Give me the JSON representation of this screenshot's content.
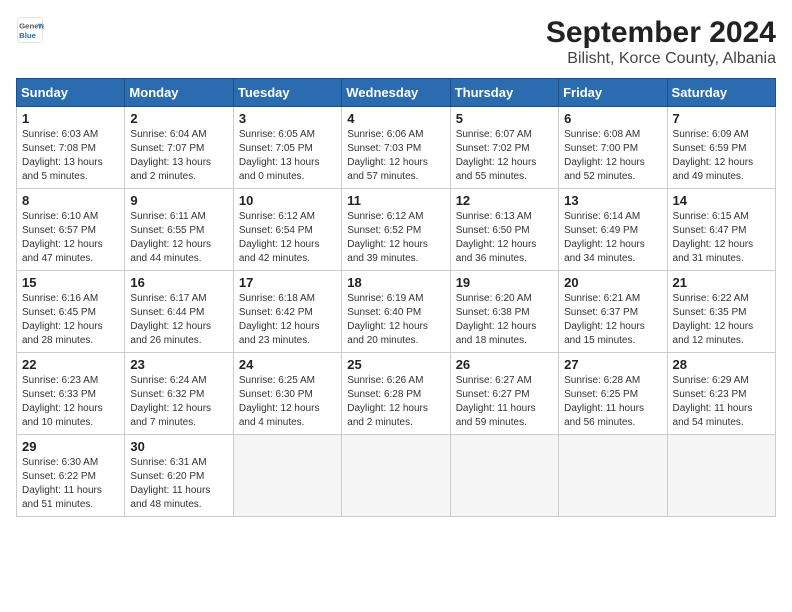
{
  "header": {
    "logo_line1": "General",
    "logo_line2": "Blue",
    "title": "September 2024",
    "subtitle": "Bilisht, Korce County, Albania"
  },
  "columns": [
    "Sunday",
    "Monday",
    "Tuesday",
    "Wednesday",
    "Thursday",
    "Friday",
    "Saturday"
  ],
  "weeks": [
    [
      {
        "day": "1",
        "info": "Sunrise: 6:03 AM\nSunset: 7:08 PM\nDaylight: 13 hours\nand 5 minutes."
      },
      {
        "day": "2",
        "info": "Sunrise: 6:04 AM\nSunset: 7:07 PM\nDaylight: 13 hours\nand 2 minutes."
      },
      {
        "day": "3",
        "info": "Sunrise: 6:05 AM\nSunset: 7:05 PM\nDaylight: 13 hours\nand 0 minutes."
      },
      {
        "day": "4",
        "info": "Sunrise: 6:06 AM\nSunset: 7:03 PM\nDaylight: 12 hours\nand 57 minutes."
      },
      {
        "day": "5",
        "info": "Sunrise: 6:07 AM\nSunset: 7:02 PM\nDaylight: 12 hours\nand 55 minutes."
      },
      {
        "day": "6",
        "info": "Sunrise: 6:08 AM\nSunset: 7:00 PM\nDaylight: 12 hours\nand 52 minutes."
      },
      {
        "day": "7",
        "info": "Sunrise: 6:09 AM\nSunset: 6:59 PM\nDaylight: 12 hours\nand 49 minutes."
      }
    ],
    [
      {
        "day": "8",
        "info": "Sunrise: 6:10 AM\nSunset: 6:57 PM\nDaylight: 12 hours\nand 47 minutes."
      },
      {
        "day": "9",
        "info": "Sunrise: 6:11 AM\nSunset: 6:55 PM\nDaylight: 12 hours\nand 44 minutes."
      },
      {
        "day": "10",
        "info": "Sunrise: 6:12 AM\nSunset: 6:54 PM\nDaylight: 12 hours\nand 42 minutes."
      },
      {
        "day": "11",
        "info": "Sunrise: 6:12 AM\nSunset: 6:52 PM\nDaylight: 12 hours\nand 39 minutes."
      },
      {
        "day": "12",
        "info": "Sunrise: 6:13 AM\nSunset: 6:50 PM\nDaylight: 12 hours\nand 36 minutes."
      },
      {
        "day": "13",
        "info": "Sunrise: 6:14 AM\nSunset: 6:49 PM\nDaylight: 12 hours\nand 34 minutes."
      },
      {
        "day": "14",
        "info": "Sunrise: 6:15 AM\nSunset: 6:47 PM\nDaylight: 12 hours\nand 31 minutes."
      }
    ],
    [
      {
        "day": "15",
        "info": "Sunrise: 6:16 AM\nSunset: 6:45 PM\nDaylight: 12 hours\nand 28 minutes."
      },
      {
        "day": "16",
        "info": "Sunrise: 6:17 AM\nSunset: 6:44 PM\nDaylight: 12 hours\nand 26 minutes."
      },
      {
        "day": "17",
        "info": "Sunrise: 6:18 AM\nSunset: 6:42 PM\nDaylight: 12 hours\nand 23 minutes."
      },
      {
        "day": "18",
        "info": "Sunrise: 6:19 AM\nSunset: 6:40 PM\nDaylight: 12 hours\nand 20 minutes."
      },
      {
        "day": "19",
        "info": "Sunrise: 6:20 AM\nSunset: 6:38 PM\nDaylight: 12 hours\nand 18 minutes."
      },
      {
        "day": "20",
        "info": "Sunrise: 6:21 AM\nSunset: 6:37 PM\nDaylight: 12 hours\nand 15 minutes."
      },
      {
        "day": "21",
        "info": "Sunrise: 6:22 AM\nSunset: 6:35 PM\nDaylight: 12 hours\nand 12 minutes."
      }
    ],
    [
      {
        "day": "22",
        "info": "Sunrise: 6:23 AM\nSunset: 6:33 PM\nDaylight: 12 hours\nand 10 minutes."
      },
      {
        "day": "23",
        "info": "Sunrise: 6:24 AM\nSunset: 6:32 PM\nDaylight: 12 hours\nand 7 minutes."
      },
      {
        "day": "24",
        "info": "Sunrise: 6:25 AM\nSunset: 6:30 PM\nDaylight: 12 hours\nand 4 minutes."
      },
      {
        "day": "25",
        "info": "Sunrise: 6:26 AM\nSunset: 6:28 PM\nDaylight: 12 hours\nand 2 minutes."
      },
      {
        "day": "26",
        "info": "Sunrise: 6:27 AM\nSunset: 6:27 PM\nDaylight: 11 hours\nand 59 minutes."
      },
      {
        "day": "27",
        "info": "Sunrise: 6:28 AM\nSunset: 6:25 PM\nDaylight: 11 hours\nand 56 minutes."
      },
      {
        "day": "28",
        "info": "Sunrise: 6:29 AM\nSunset: 6:23 PM\nDaylight: 11 hours\nand 54 minutes."
      }
    ],
    [
      {
        "day": "29",
        "info": "Sunrise: 6:30 AM\nSunset: 6:22 PM\nDaylight: 11 hours\nand 51 minutes."
      },
      {
        "day": "30",
        "info": "Sunrise: 6:31 AM\nSunset: 6:20 PM\nDaylight: 11 hours\nand 48 minutes."
      },
      {
        "day": "",
        "info": ""
      },
      {
        "day": "",
        "info": ""
      },
      {
        "day": "",
        "info": ""
      },
      {
        "day": "",
        "info": ""
      },
      {
        "day": "",
        "info": ""
      }
    ]
  ]
}
